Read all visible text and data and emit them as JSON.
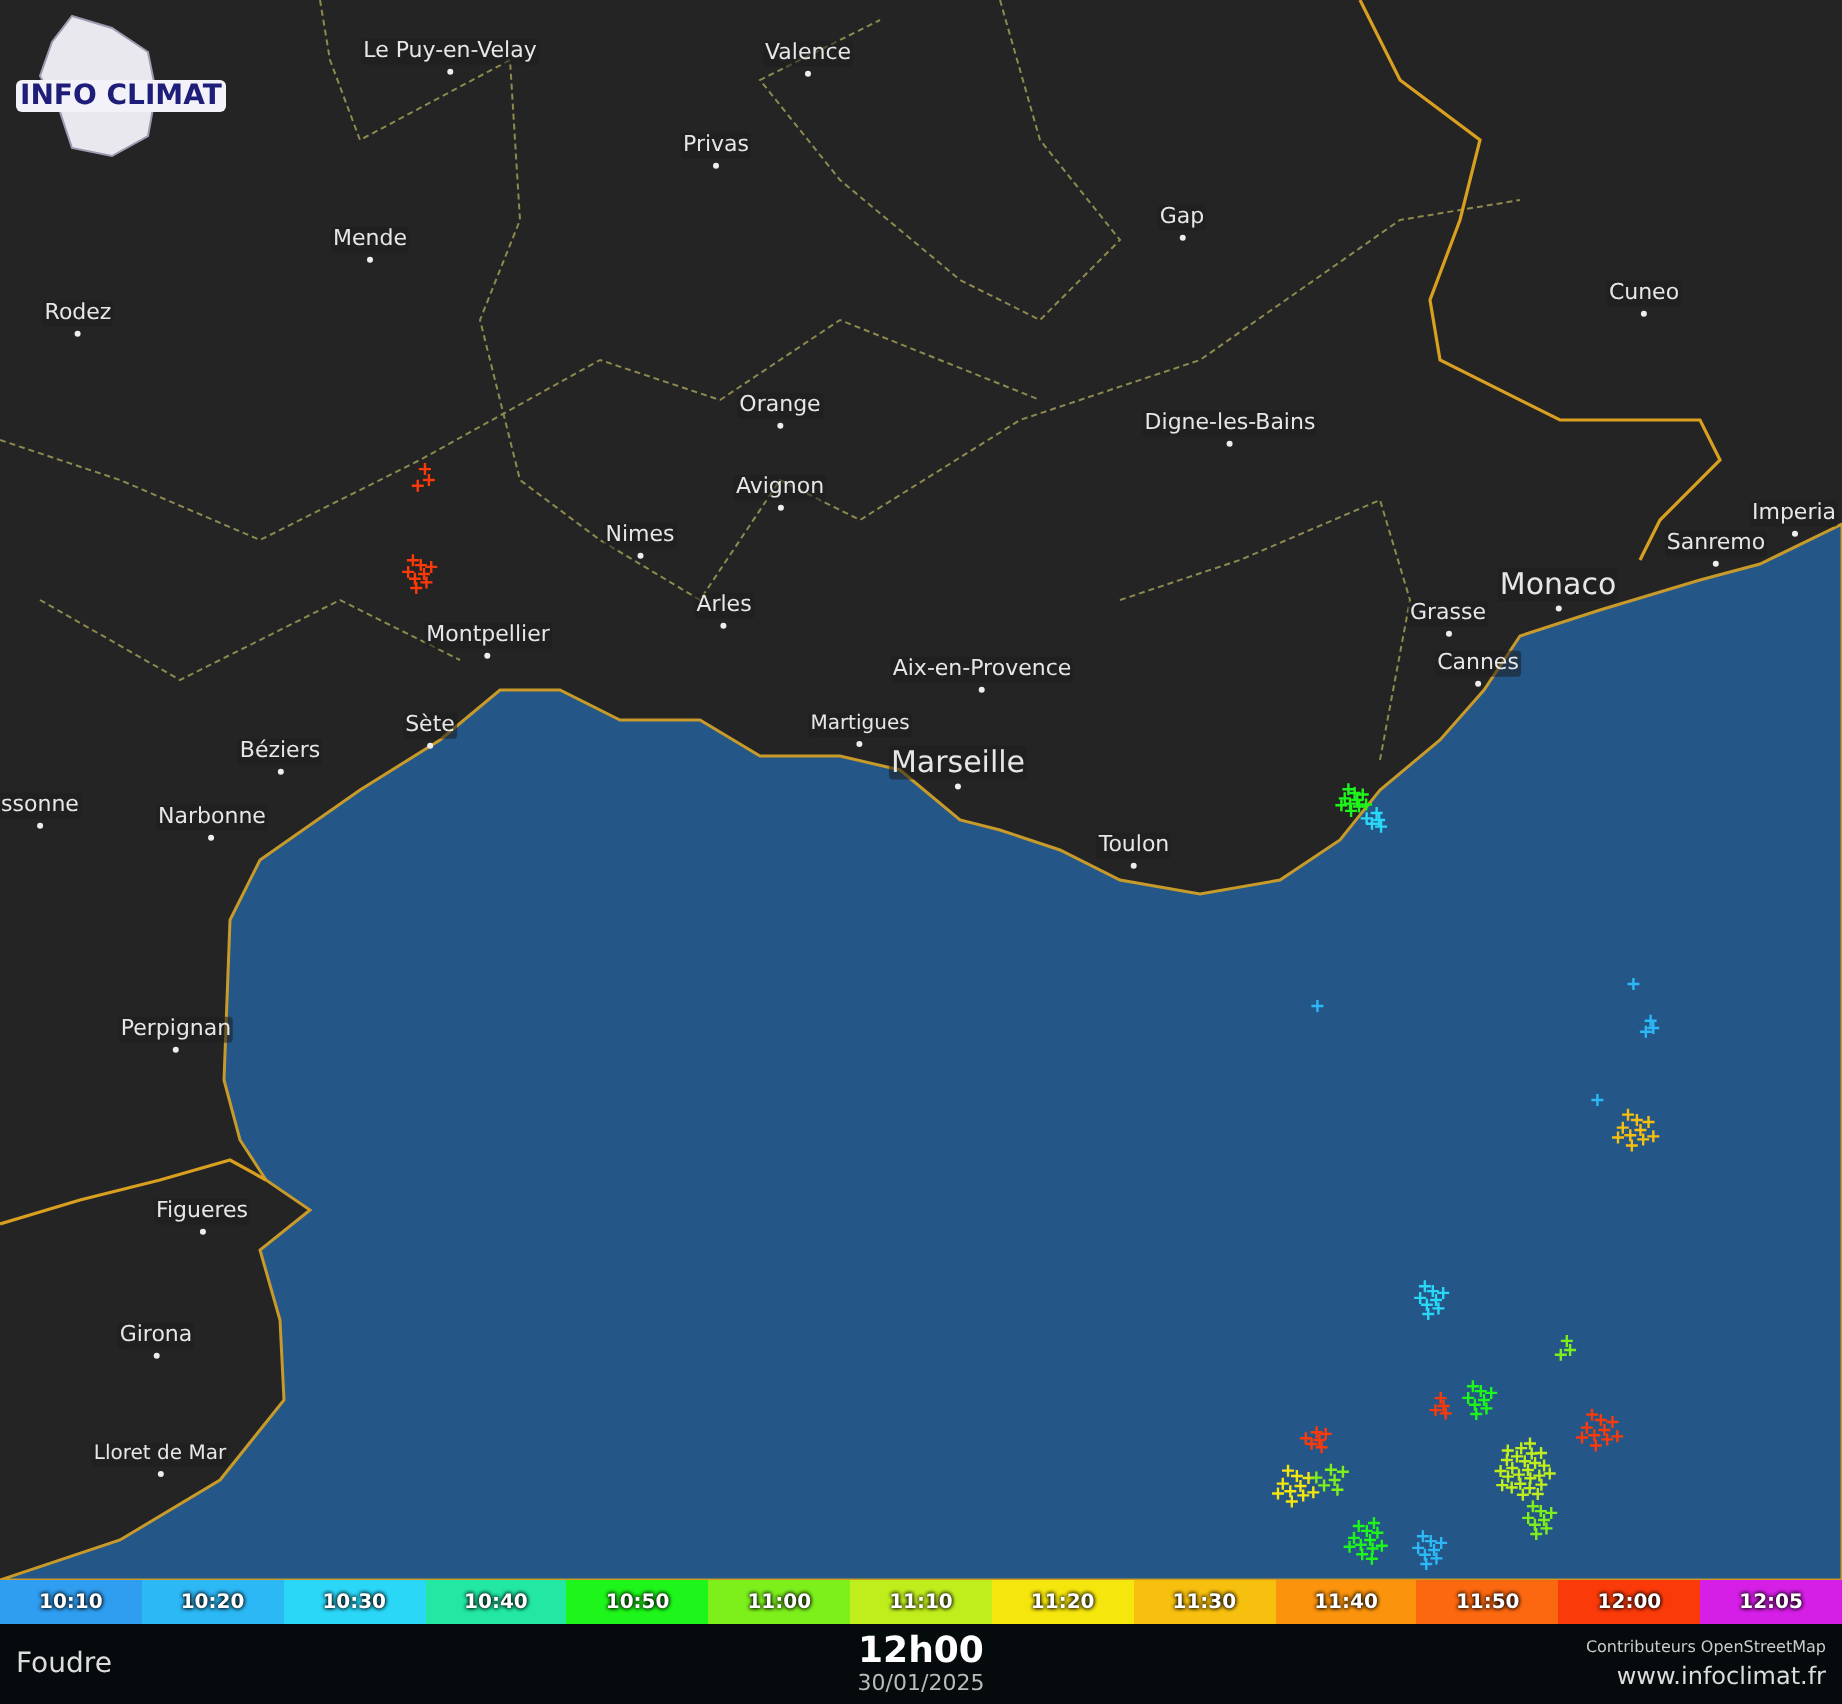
{
  "logo": {
    "text": "INFO CLIMAT"
  },
  "cities": [
    "Le Puy-en-Velay",
    "Valence",
    "Privas",
    "Mende",
    "Rodez",
    "Gap",
    "Cuneo",
    "Orange",
    "Digne-les-Bains",
    "Avignon",
    "Nimes",
    "Arles",
    "Montpellier",
    "Aix-en-Provence",
    "Grasse",
    "Cannes",
    "Monaco",
    "Sanremo",
    "Imperia",
    "Sète",
    "Martigues",
    "Béziers",
    "Marseille",
    "Toulon",
    "ssonne",
    "Narbonne",
    "Perpignan",
    "Figueres",
    "Girona",
    "Lloret de Mar"
  ],
  "legend": [
    {
      "label": "10:10",
      "color": "#2f9df0"
    },
    {
      "label": "10:20",
      "color": "#2cb8f5"
    },
    {
      "label": "10:30",
      "color": "#2ad7f7"
    },
    {
      "label": "10:40",
      "color": "#22e8a4"
    },
    {
      "label": "10:50",
      "color": "#1ef51a"
    },
    {
      "label": "11:00",
      "color": "#7df01c"
    },
    {
      "label": "11:10",
      "color": "#c0ee1c"
    },
    {
      "label": "11:20",
      "color": "#f5e60e"
    },
    {
      "label": "11:30",
      "color": "#f8c00e"
    },
    {
      "label": "11:40",
      "color": "#fb930d"
    },
    {
      "label": "11:50",
      "color": "#fb6810"
    },
    {
      "label": "12:00",
      "color": "#fb3a0a"
    },
    {
      "label": "12:05",
      "color": "#d51ee6"
    }
  ],
  "footer": {
    "title": "Foudre",
    "time": "12h00",
    "date": "30/01/2025",
    "credit": "Contributeurs OpenStreetMap",
    "site": "www.infoclimat.fr"
  }
}
